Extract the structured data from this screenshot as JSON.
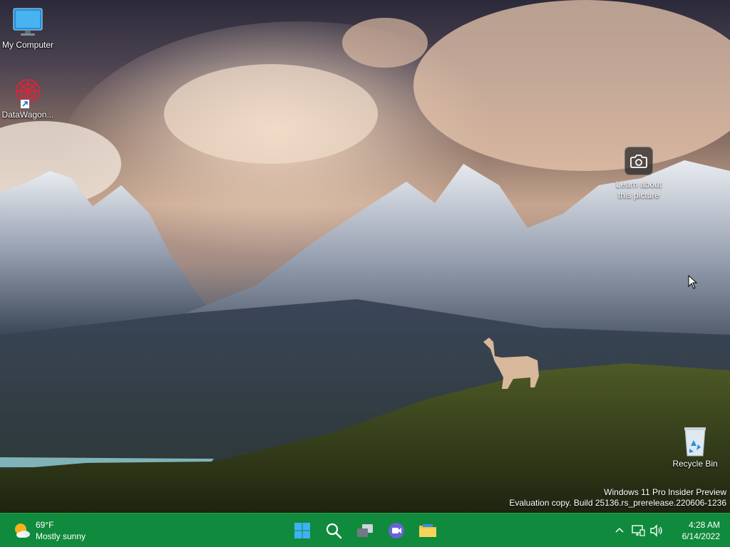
{
  "desktop": {
    "icons": [
      {
        "label": "My Computer"
      },
      {
        "label": "DataWagon..."
      },
      {
        "label": "Recycle Bin"
      }
    ],
    "spotlight": {
      "line1": "Learn about",
      "line2": "this picture"
    },
    "watermark": {
      "line1": "Windows 11 Pro Insider Preview",
      "line2": "Evaluation copy. Build 25136.rs_prerelease.220606-1236"
    }
  },
  "taskbar": {
    "color": "#108a3c",
    "weather": {
      "temp": "69°F",
      "condition": "Mostly sunny",
      "icon": "partly-sunny-icon"
    },
    "pinned": [
      {
        "name": "start-button",
        "icon": "windows-logo-icon"
      },
      {
        "name": "search-button",
        "icon": "search-icon"
      },
      {
        "name": "task-view-button",
        "icon": "task-view-icon"
      },
      {
        "name": "chat-button",
        "icon": "teams-chat-icon"
      },
      {
        "name": "file-explorer-button",
        "icon": "folder-icon"
      }
    ],
    "tray": {
      "icons": [
        "chevron-up-icon",
        "network-icon",
        "volume-icon"
      ],
      "time": "4:28 AM",
      "date": "6/14/2022"
    }
  }
}
